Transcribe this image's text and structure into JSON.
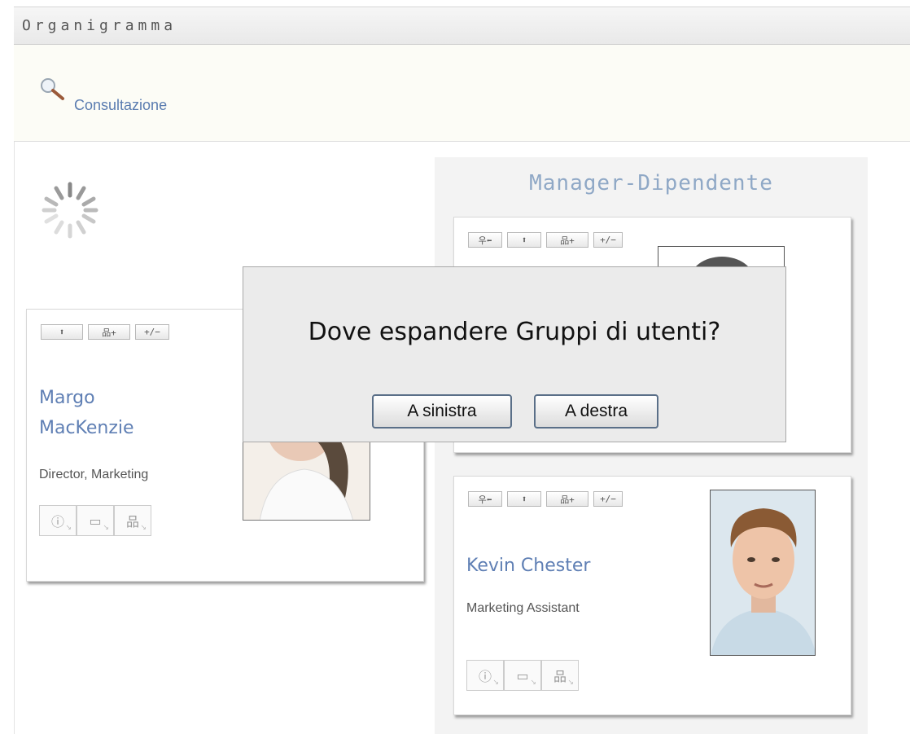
{
  "header": {
    "title": "Organigramma"
  },
  "search": {
    "link_label": "Consultazione"
  },
  "panel": {
    "title": "Manager-Dipendente"
  },
  "toolbar_labels": {
    "expand_up": "⬆",
    "add_groups": "品+",
    "toggle": "+/−",
    "manager": "우⬅"
  },
  "cards": {
    "margo": {
      "name": "Margo MacKenzie",
      "role": "Director, Marketing"
    },
    "kevin": {
      "name": "Kevin Chester",
      "role": "Marketing Assistant"
    }
  },
  "dialog": {
    "question": "Dove espandere Gruppi di utenti?",
    "left_button": "A sinistra",
    "right_button": "A destra"
  }
}
